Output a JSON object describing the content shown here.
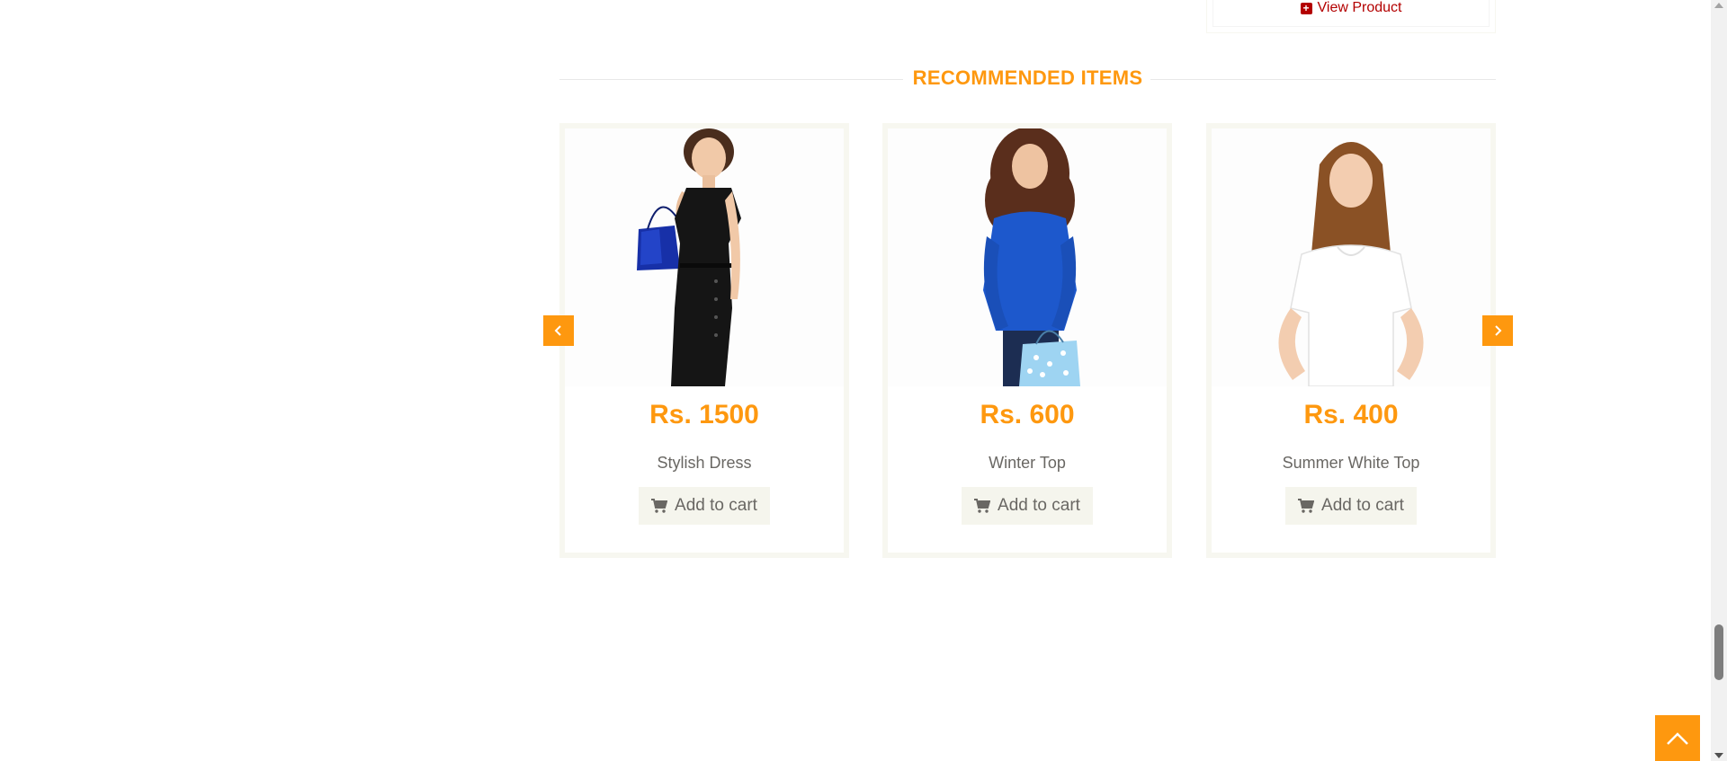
{
  "previous_card": {
    "view_product_label": "View Product"
  },
  "section": {
    "title": "RECOMMENDED ITEMS"
  },
  "products": [
    {
      "price": "Rs. 1500",
      "name": "Stylish Dress",
      "cart_label": "Add to cart",
      "image": "woman in black dress holding blue shopping bag"
    },
    {
      "price": "Rs. 600",
      "name": "Winter Top",
      "cart_label": "Add to cart",
      "image": "woman in blue top holding light-blue shopping bag"
    },
    {
      "price": "Rs. 400",
      "name": "Summer White Top",
      "cart_label": "Add to cart",
      "image": "woman in white t-shirt with hands on hips"
    }
  ],
  "colors": {
    "accent": "#fe980f",
    "price": "#fe980f",
    "text": "#696763",
    "view_product": "#b30000",
    "button_bg": "#f5f5ed",
    "card_border": "#f7f7f0"
  },
  "icons": {
    "prev": "chevron-left-icon",
    "next": "chevron-right-icon",
    "cart": "shopping-cart-icon",
    "plus": "plus-square-icon",
    "scroll_up": "chevron-up-icon"
  }
}
